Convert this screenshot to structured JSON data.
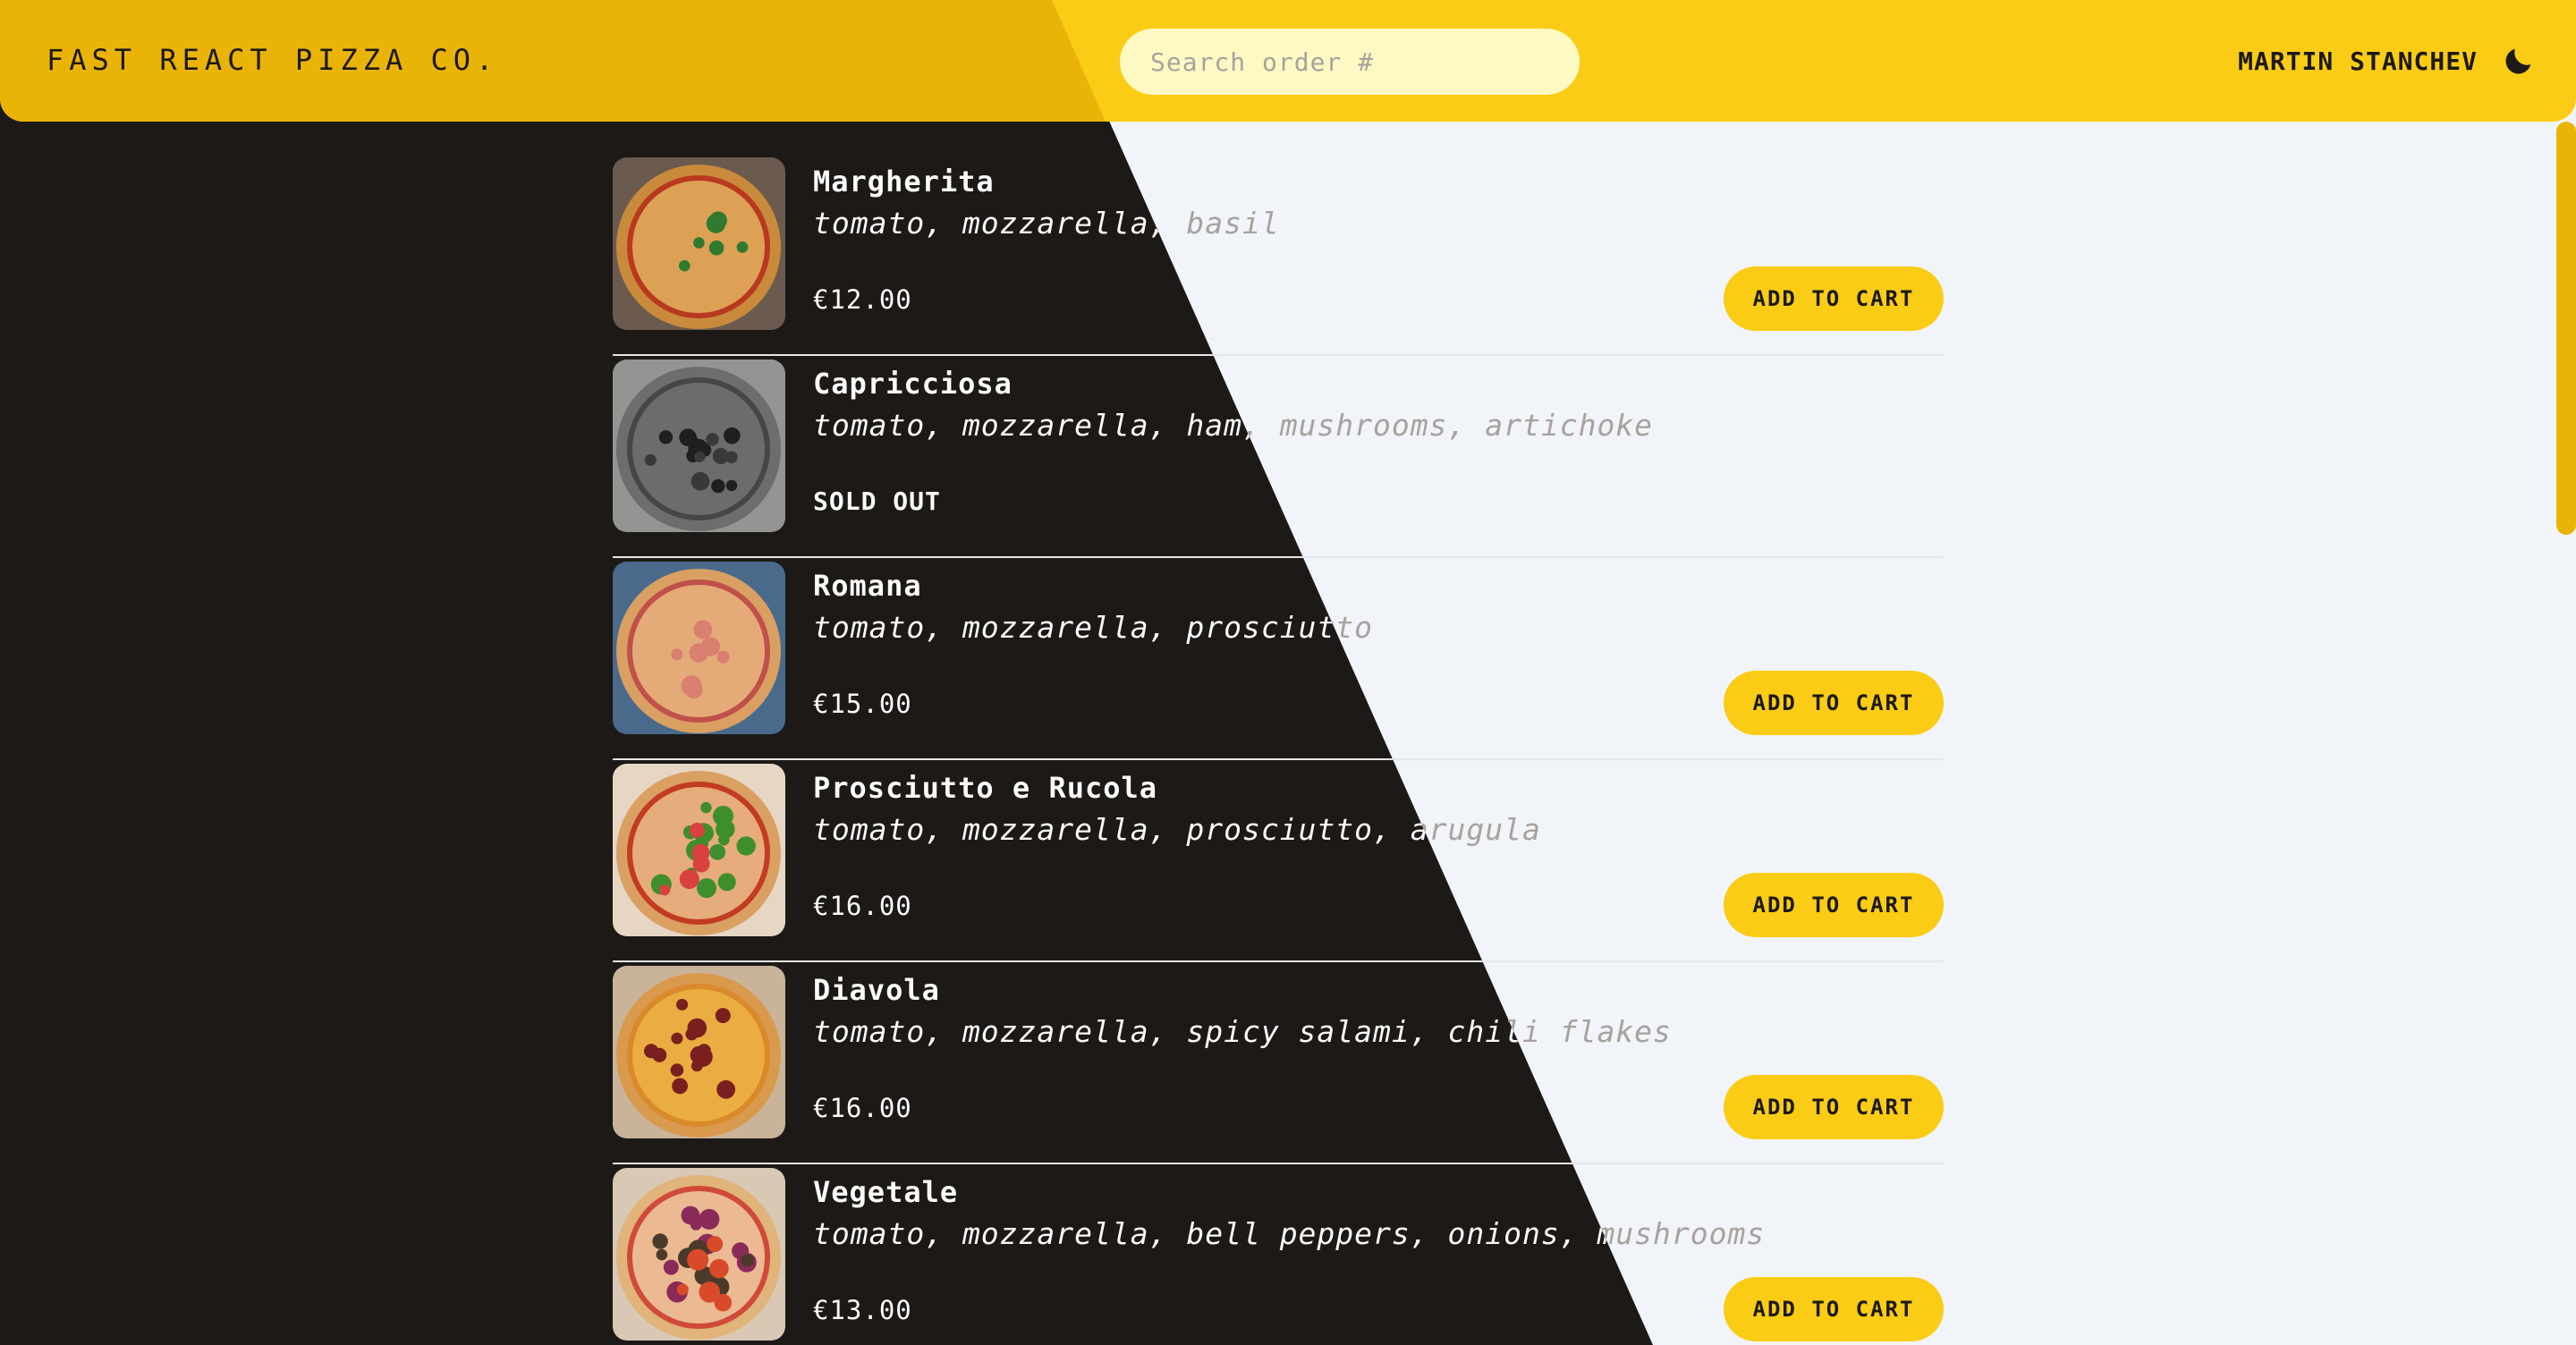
{
  "header": {
    "logo": "FAST REACT PIZZA CO.",
    "search_placeholder": "Search order #",
    "username": "MARTIN STANCHEV",
    "theme_toggle_icon": "moon-icon"
  },
  "colors": {
    "brand_yellow": "#facc15",
    "brand_yellow_dark": "#eab308",
    "dark_bg": "#1c1917",
    "light_bg": "#f1f4f8"
  },
  "menu": {
    "items": [
      {
        "name": "Margherita",
        "ingredients": "tomato, mozzarella, basil",
        "price": "€12.00",
        "sold_out": false,
        "button": "ADD TO CART",
        "image": "margherita-pizza-photo"
      },
      {
        "name": "Capricciosa",
        "ingredients": "tomato, mozzarella, ham, mushrooms, artichoke",
        "status": "SOLD OUT",
        "sold_out": true,
        "image": "capricciosa-pizza-photo"
      },
      {
        "name": "Romana",
        "ingredients": "tomato, mozzarella, prosciutto",
        "price": "€15.00",
        "sold_out": false,
        "button": "ADD TO CART",
        "image": "romana-pizza-photo"
      },
      {
        "name": "Prosciutto e Rucola",
        "ingredients": "tomato, mozzarella, prosciutto, arugula",
        "price": "€16.00",
        "sold_out": false,
        "button": "ADD TO CART",
        "image": "prosciutto-rucola-pizza-photo"
      },
      {
        "name": "Diavola",
        "ingredients": "tomato, mozzarella, spicy salami, chili flakes",
        "price": "€16.00",
        "sold_out": false,
        "button": "ADD TO CART",
        "image": "diavola-pizza-photo"
      },
      {
        "name": "Vegetale",
        "ingredients": "tomato, mozzarella, bell peppers, onions, mushrooms",
        "price": "€13.00",
        "sold_out": false,
        "button": "ADD TO CART",
        "image": "vegetale-pizza-photo"
      }
    ]
  }
}
